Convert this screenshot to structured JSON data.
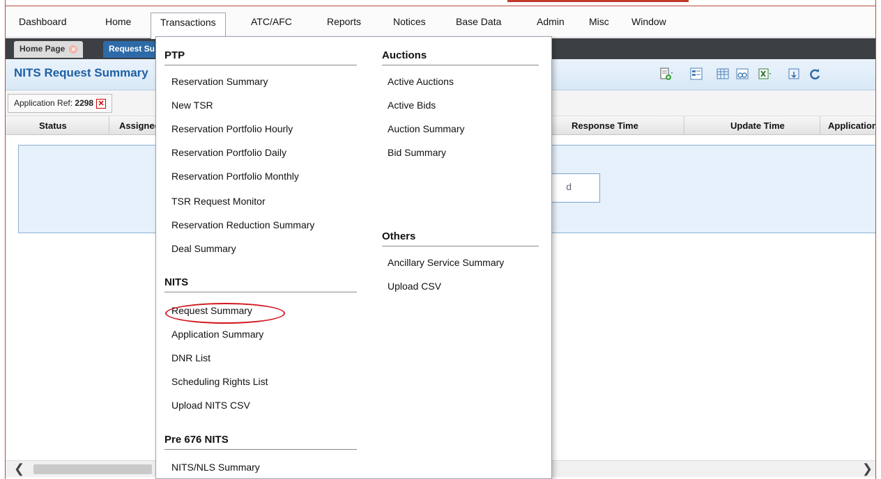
{
  "menubar": {
    "items": [
      "Dashboard",
      "Home",
      "Transactions",
      "ATC/AFC",
      "Reports",
      "Notices",
      "Base Data",
      "Admin",
      "Misc",
      "Window"
    ]
  },
  "tabs": {
    "home": "Home Page",
    "current": "Request Summary"
  },
  "page": {
    "title": "NITS Request Summary"
  },
  "filter": {
    "label": "Application Ref:",
    "value": "2298"
  },
  "grid": {
    "columns": [
      "Status",
      "Assigned",
      "Response Time",
      "Update Time",
      "Application"
    ],
    "loading_text": "d"
  },
  "dropdown": {
    "left": {
      "groups": [
        {
          "title": "PTP",
          "items": [
            "Reservation Summary",
            "New TSR",
            "Reservation Portfolio Hourly",
            "Reservation Portfolio Daily",
            "Reservation Portfolio Monthly",
            "TSR Request Monitor",
            "Reservation Reduction Summary",
            "Deal Summary"
          ]
        },
        {
          "title": "NITS",
          "items": [
            "Request Summary",
            "Application Summary",
            "DNR List",
            "Scheduling Rights List",
            "Upload NITS CSV"
          ]
        },
        {
          "title": "Pre 676 NITS",
          "items": [
            "NITS/NLS Summary"
          ]
        }
      ]
    },
    "right": {
      "groups": [
        {
          "title": "Auctions",
          "items": [
            "Active Auctions",
            "Active Bids",
            "Auction Summary",
            "Bid Summary"
          ]
        },
        {
          "title": "Others",
          "items": [
            "Ancillary Service Summary",
            "Upload CSV"
          ]
        }
      ]
    }
  },
  "colors": {
    "accent": "#1f5fa3",
    "highlight": "#d0181f"
  }
}
